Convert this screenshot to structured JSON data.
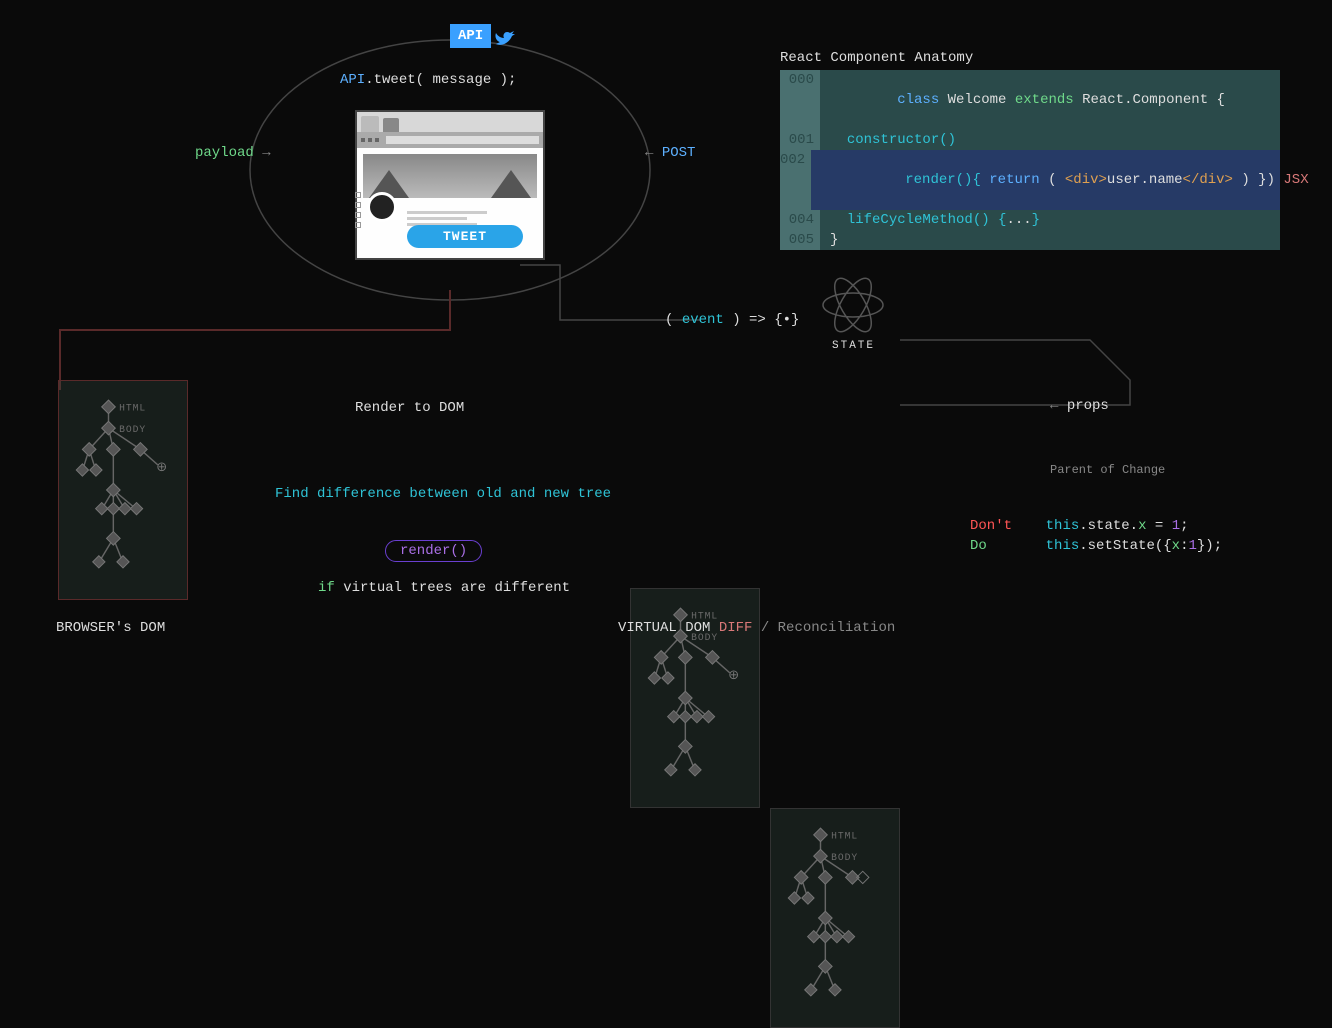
{
  "api": {
    "badge": "API",
    "call": "API.tweet( message );"
  },
  "labels": {
    "payload": "payload",
    "post": "POST",
    "tweetBtn": "TWEET",
    "renderToDom": "Render to DOM",
    "findDiff": "Find difference between old and new tree",
    "renderPill": "render()",
    "ifDiff_if": "if",
    "ifDiff_rest": " virtual trees are different",
    "browsersDom": "BROWSER's DOM",
    "virtualDom": "VIRTUAL DOM",
    "diff": "DIFF",
    "recon": " / Reconciliation",
    "props": "props",
    "event_open": "( ",
    "event_word": "event",
    "event_close": " ) => {•}",
    "state": "STATE",
    "parentChange": "Parent of Change",
    "dont": "Don't",
    "do": "Do",
    "badState": "this.state.x = 1;",
    "goodState": "this.setState({x:1});",
    "bad_this": "this",
    "bad_state": ".state.",
    "bad_x": "x",
    "bad_eq": " = ",
    "bad_one": "1",
    "bad_semi": ";",
    "good_this": "this",
    "good_set": ".setState({",
    "good_x": "x",
    "good_colon": ":",
    "good_one": "1",
    "good_end": "});"
  },
  "tree": {
    "html": "HTML",
    "body": "BODY"
  },
  "anatomy": {
    "title": "React Component Anatomy",
    "lines": [
      {
        "n": "000",
        "t": "class Welcome extends React.Component {"
      },
      {
        "n": "001",
        "t": "  constructor()"
      },
      {
        "n": "002",
        "t": "  render(){ return ( <div>user.name</div> ) }) JSX"
      },
      {
        "n": "004",
        "t": "  lifeCycleMethod() {...}"
      },
      {
        "n": "005",
        "t": "}"
      }
    ],
    "tok": {
      "class": "class",
      "welcome": " Welcome ",
      "extends": "extends",
      "react": " React",
      "dot": ".",
      "component": "Component {",
      "constructor": "constructor()",
      "render": "render(){ ",
      "return": "return",
      "paren_open": " ( ",
      "div_open": "<div>",
      "username": "user.name",
      "div_close": "</div>",
      "paren_close": " ) }) ",
      "jsx": "JSX",
      "lifecycle": "lifeCycleMethod() {",
      "dots": "...",
      "brace": "}",
      "brace2": "}"
    }
  }
}
